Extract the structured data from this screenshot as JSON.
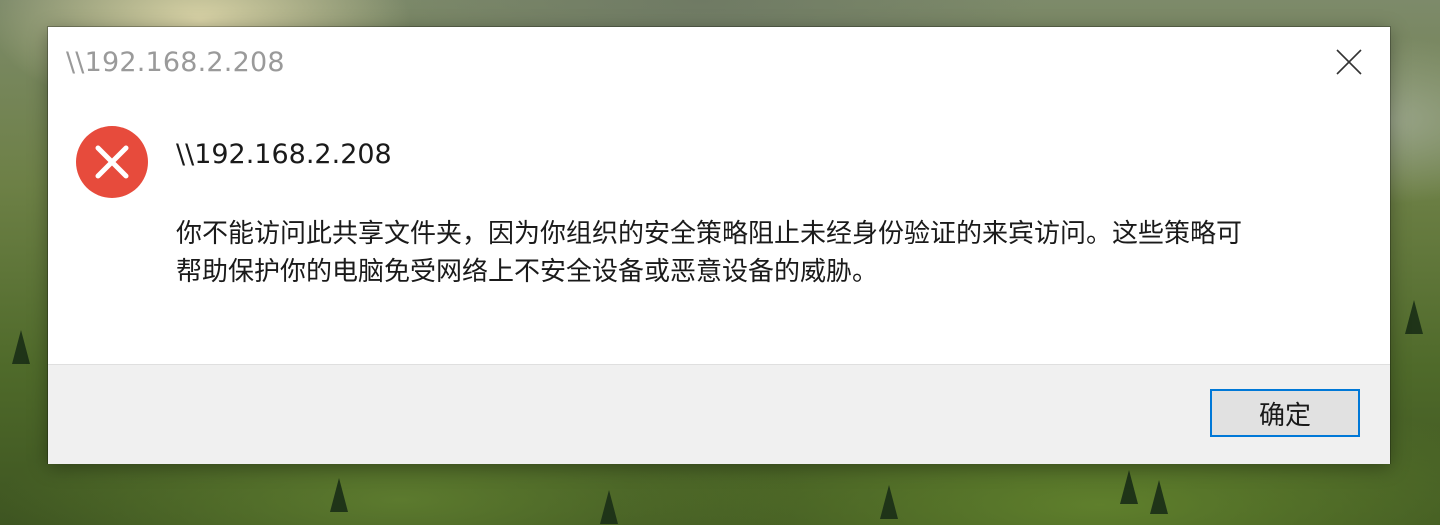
{
  "dialog": {
    "window_title": "\\\\192.168.2.208",
    "heading": "\\\\192.168.2.208",
    "message_line1": "你不能访问此共享文件夹，因为你组织的安全策略阻止未经身份验证的来宾访问。这些策略可",
    "message_line2": "帮助保护你的电脑免受网络上不安全设备或恶意设备的威胁。",
    "ok_label": "确定",
    "icon": "error-icon",
    "close_icon": "close-icon"
  },
  "colors": {
    "error_red": "#e74b3c",
    "button_border": "#0078d7",
    "footer_bg": "#f0f0f0",
    "title_text": "#9a9a9a"
  }
}
